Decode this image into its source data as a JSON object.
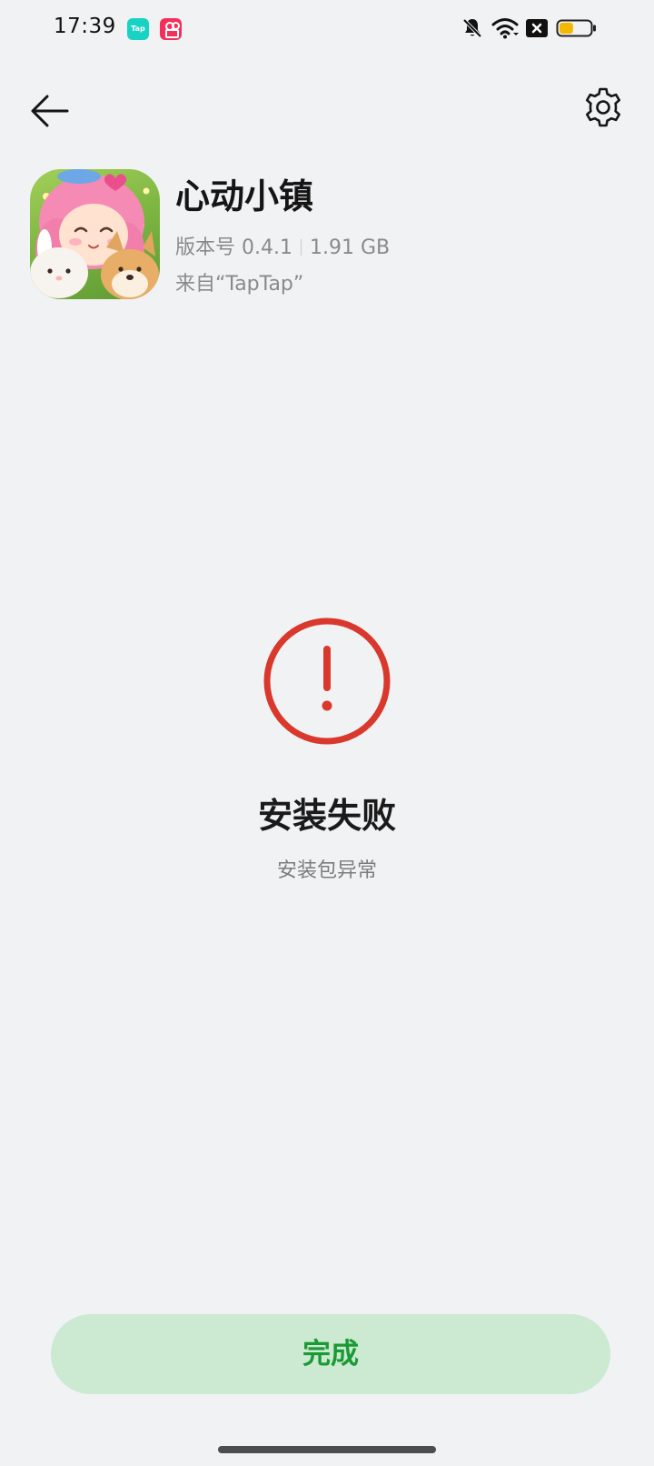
{
  "status_bar": {
    "time": "17:39",
    "notification_icons": [
      "taptap-icon",
      "kuaishou-icon"
    ],
    "tap_badge_text": "Tap",
    "system_icons": [
      "bell-muted-icon",
      "wifi-icon",
      "sim-off-icon",
      "battery-icon"
    ],
    "battery_level": 0.45,
    "battery_color": "#f5b800"
  },
  "header": {
    "back_icon": "arrow-left-icon",
    "settings_icon": "gear-icon"
  },
  "app": {
    "name": "心动小镇",
    "version_label": "版本号 0.4.1",
    "size": "1.91 GB",
    "source": "来自“TapTap”"
  },
  "result": {
    "icon": "exclamation-circle-icon",
    "icon_color": "#d9382c",
    "title": "安装失败",
    "subtitle": "安装包异常"
  },
  "actions": {
    "done_label": "完成",
    "done_bg_color": "#cce9d2",
    "done_text_color": "#1a9a34"
  }
}
